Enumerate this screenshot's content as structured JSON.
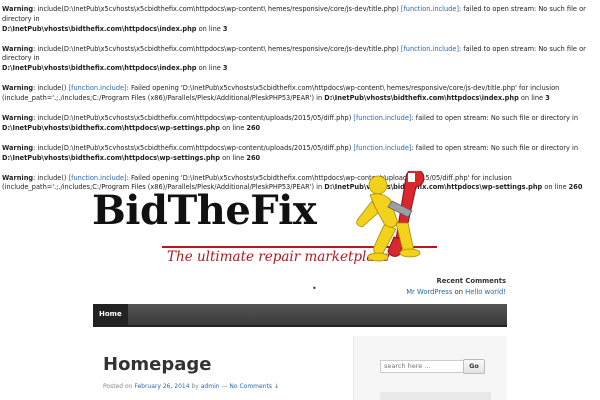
{
  "warnings": [
    {
      "label": "Warning",
      "pre": ": include(D:\\InetPub\\x5cvhosts\\x5cbidthefix.com\\httpdocs\\wp-content\\ hemes/responsive/core/js-dev/title.php) ",
      "link": "[function.include]",
      "post": ": failed to open stream: No such file or directory in",
      "path": "D:\\InetPub\\vhosts\\bidthefix.com\\httpdocs\\index.php",
      "line_label": " on line ",
      "line": "3"
    },
    {
      "label": "Warning",
      "pre": ": include(D:\\InetPub\\x5cvhosts\\x5cbidthefix.com\\httpdocs\\wp-content\\ hemes/responsive/core/js-dev/title.php) ",
      "link": "[function.include]",
      "post": ": failed to open stream: No such file or directory in",
      "path": "D:\\InetPub\\vhosts\\bidthefix.com\\httpdocs\\index.php",
      "line_label": " on line ",
      "line": "3"
    },
    {
      "label": "Warning",
      "pre": ": include() ",
      "link": "[function.include]",
      "post": ": Failed opening 'D:\\InetPub\\x5cvhosts\\x5cbidthefix.com\\httpdocs\\wp-content\\ hemes/responsive/core/js-dev/title.php' for inclusion (include_path='.;./includes;C:/Program Files (x86)/Parallels/Plesk/Additional/PleskPHP53/PEAR') in",
      "path": "D:\\InetPub\\vhosts\\bidthefix.com\\httpdocs\\index.php",
      "line_label": " on line ",
      "line": "3"
    },
    {
      "label": "Warning",
      "pre": ": include(D:\\InetPub\\x5cvhosts\\x5cbidthefix.com\\httpdocs\\wp-content/uploads/2015/05/diff.php) ",
      "link": "[function.include]",
      "post": ": failed to open stream: No such file or directory in",
      "path": "D:\\InetPub\\vhosts\\bidthefix.com\\httpdocs\\wp-settings.php",
      "line_label": " on line ",
      "line": "260"
    },
    {
      "label": "Warning",
      "pre": ": include(D:\\InetPub\\x5cvhosts\\x5cbidthefix.com\\httpdocs\\wp-content/uploads/2015/05/diff.php) ",
      "link": "[function.include]",
      "post": ": failed to open stream: No such file or directory in",
      "path": "D:\\InetPub\\vhosts\\bidthefix.com\\httpdocs\\wp-settings.php",
      "line_label": " on line ",
      "line": "260"
    },
    {
      "label": "Warning",
      "pre": ": include() ",
      "link": "[function.include]",
      "post": ": Failed opening 'D:\\InetPub\\x5cvhosts\\x5cbidthefix.com\\httpdocs\\wp-content/uploads/2015/05/diff.php' for inclusion (include_path='.;./includes;C:/Program Files (x86)/Parallels/Plesk/Additional/PleskPHP53/PEAR') in",
      "path": "D:\\InetPub\\vhosts\\bidthefix.com\\httpdocs\\wp-settings.php",
      "line_label": " on line ",
      "line": "260"
    }
  ],
  "logo": {
    "text": "BidTheFix",
    "tagline": "The ultimate repair marketplace",
    "mascot_icon": "wrench-mascot-icon",
    "colors": {
      "text": "#111111",
      "tagline": "#b5171e",
      "wrench": "#d9272e",
      "mascot": "#f2d21b"
    }
  },
  "recent_comments": {
    "heading": "Recent Comments",
    "author": "Mr WordPress",
    "on": " on ",
    "post": "Hello world!"
  },
  "nav": {
    "items": [
      "Home"
    ]
  },
  "post": {
    "title": "Homepage",
    "posted_on": "Posted on ",
    "date": "February 26, 2014",
    "by": " by ",
    "author": "admin",
    "sep": " — ",
    "comments": "No Comments ↓"
  },
  "search": {
    "placeholder": "search here ...",
    "button": "Go"
  },
  "colors": {
    "link": "#2a67b1",
    "navbar": "#3a3a3a",
    "background": "#ffffff"
  }
}
